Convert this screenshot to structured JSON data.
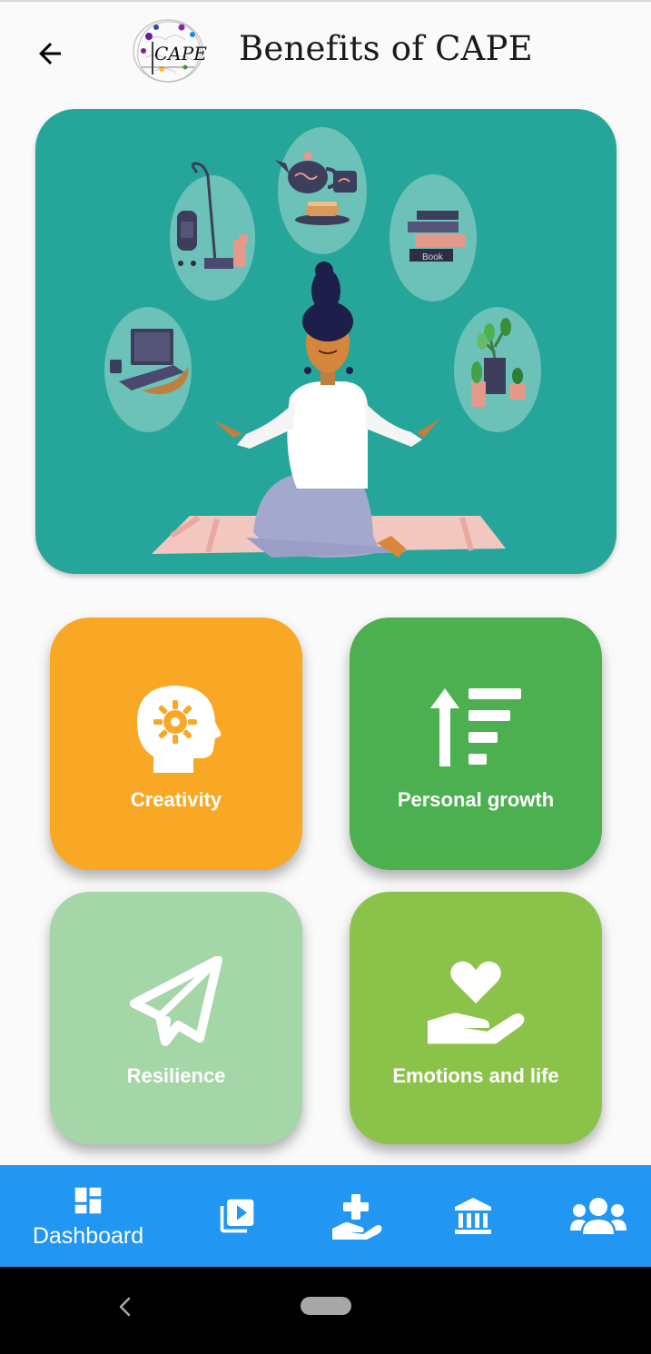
{
  "appbar": {
    "title": "Benefits of CAPE",
    "logo_text": "CAPE",
    "back_icon": "arrow-left-icon"
  },
  "hero": {
    "book_label": "Book"
  },
  "cards": [
    {
      "label": "Creativity",
      "icon": "head-gear-icon",
      "color": "#f9a825"
    },
    {
      "label": "Personal growth",
      "icon": "sort-arrow-up-icon",
      "color": "#4caf50"
    },
    {
      "label": "Resilience",
      "icon": "paper-plane-icon",
      "color": "#a5d6a7"
    },
    {
      "label": "Emotions and life",
      "icon": "hand-heart-icon",
      "color": "#8bc34a"
    }
  ],
  "bottom_nav": {
    "color": "#2196f3",
    "items": [
      {
        "label": "Dashboard",
        "icon": "dashboard-icon",
        "active": true
      },
      {
        "label": "",
        "icon": "video-library-icon"
      },
      {
        "label": "",
        "icon": "hand-medical-icon"
      },
      {
        "label": "",
        "icon": "institution-icon"
      },
      {
        "label": "",
        "icon": "users-icon"
      }
    ]
  }
}
